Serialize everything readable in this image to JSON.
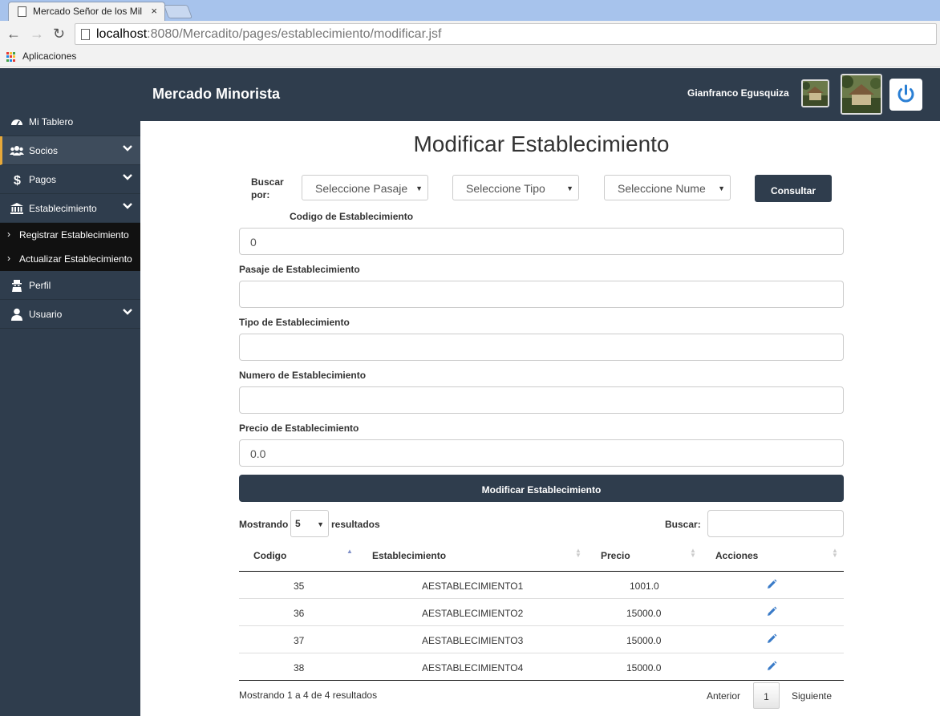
{
  "browser": {
    "tab_title": "Mercado Señor de los Mil",
    "tab_close": "×",
    "url_host": "localhost",
    "url_rest": ":8080/Mercadito/pages/establecimiento/modificar.jsf",
    "bookmark_apps": "Aplicaciones",
    "apps_colors": [
      "#e53935",
      "#fbc02d",
      "#43a047",
      "#1e88e5",
      "#e53935",
      "#fbc02d",
      "#43a047",
      "#1e88e5",
      "#e53935"
    ]
  },
  "header": {
    "brand": "Mercado Minorista",
    "user_name": "Gianfranco  Egusquiza"
  },
  "sidebar": {
    "items": [
      {
        "label": "Mi Tablero",
        "icon": "dashboard-icon"
      },
      {
        "label": "Socios",
        "icon": "users-icon"
      },
      {
        "label": "Pagos",
        "icon": "dollar-icon"
      },
      {
        "label": "Establecimiento",
        "icon": "bank-icon"
      },
      {
        "label": "Perfil",
        "icon": "user-secret-icon"
      },
      {
        "label": "Usuario",
        "icon": "user-icon"
      }
    ],
    "subitems": [
      {
        "label": "Registrar Establecimiento"
      },
      {
        "label": "Actualizar Establecimiento"
      }
    ],
    "accent_color": "#e8a93a"
  },
  "page": {
    "title": "Modificar Establecimiento",
    "buscar_label_1": "Buscar",
    "buscar_label_2": "por:",
    "selects": [
      "Seleccione Pasaje",
      "Seleccione Tipo",
      "Seleccione Nume"
    ],
    "consult_button": "Consultar"
  },
  "form": {
    "fields": [
      {
        "label": "Codigo de Establecimiento",
        "value": "0"
      },
      {
        "label": "Pasaje de Establecimiento",
        "value": ""
      },
      {
        "label": "Tipo de Establecimiento",
        "value": ""
      },
      {
        "label": "Numero de Establecimiento",
        "value": ""
      },
      {
        "label": "Precio de Establecimiento",
        "value": "0.0"
      }
    ],
    "submit_label": "Modificar Establecimiento"
  },
  "table": {
    "length_prefix": "Mostrando",
    "length_value": "5",
    "length_suffix": "resultados",
    "search_label": "Buscar:",
    "columns": [
      "Codigo",
      "Establecimiento",
      "Precio",
      "Acciones"
    ],
    "rows": [
      {
        "codigo": "35",
        "establecimiento": "AESTABLECIMIENTO1",
        "precio": "1001.0"
      },
      {
        "codigo": "36",
        "establecimiento": "AESTABLECIMIENTO2",
        "precio": "15000.0"
      },
      {
        "codigo": "37",
        "establecimiento": "AESTABLECIMIENTO3",
        "precio": "15000.0"
      },
      {
        "codigo": "38",
        "establecimiento": "AESTABLECIMIENTO4",
        "precio": "15000.0"
      }
    ],
    "info": "Mostrando 1 a 4 de 4 resultados",
    "prev": "Anterior",
    "current_page": "1",
    "next": "Siguiente"
  }
}
